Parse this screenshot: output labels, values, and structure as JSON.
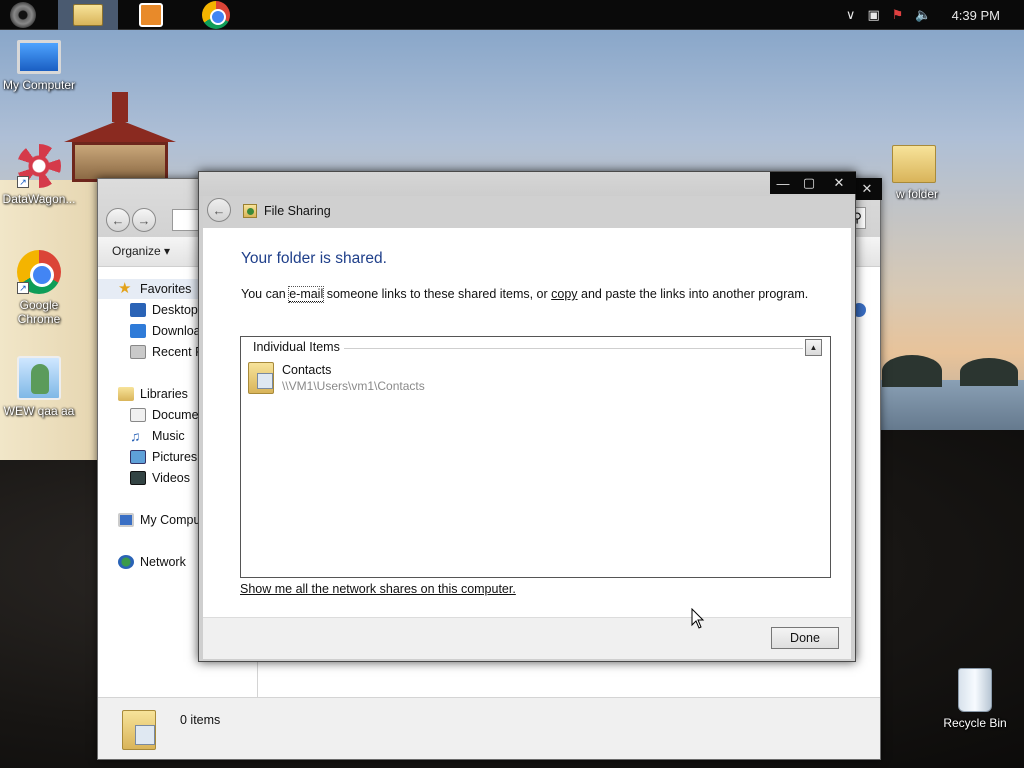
{
  "taskbar": {
    "clock": "4:39 PM",
    "apps": [
      "start-orb",
      "file-explorer",
      "media-player",
      "google-chrome"
    ],
    "tray_icons": [
      "chevron-up-icon",
      "network-icon",
      "action-center-flag-icon",
      "volume-icon"
    ]
  },
  "desktop": {
    "icons": {
      "my_computer": "My Computer",
      "datawagon": "DataWagon...",
      "google_chrome_line1": "Google",
      "google_chrome_line2": "Chrome",
      "wew": "WEW qaa aa",
      "new_folder": "w folder",
      "recycle_bin": "Recycle Bin"
    }
  },
  "explorer": {
    "toolbar": {
      "organize": "Organize"
    },
    "nav": {
      "favorites": "Favorites",
      "desktop": "Desktop",
      "downloads": "Downloa",
      "recent": "Recent P",
      "libraries": "Libraries",
      "documents": "Docume",
      "music": "Music",
      "pictures": "Pictures",
      "videos": "Videos",
      "my_computer": "My Compu",
      "network": "Network"
    },
    "status": {
      "items": "0 items"
    }
  },
  "dialog": {
    "title": "File Sharing",
    "headline": "Your folder is shared.",
    "instruction": {
      "prefix": "You can ",
      "email_link": "e-mail",
      "middle": " someone links to these shared items, or ",
      "copy_link": "copy",
      "suffix": " and paste the links into another program."
    },
    "list": {
      "group_header": "Individual Items",
      "items": [
        {
          "name": "Contacts",
          "path": "\\\\VM1\\Users\\vm1\\Contacts"
        }
      ]
    },
    "network_shares_link": "Show me all the network shares on this computer.",
    "done_button": "Done"
  },
  "colors": {
    "headline": "#1f3f8a",
    "taskbar": "#0a0a0a",
    "path_text": "#8a8a8a"
  }
}
